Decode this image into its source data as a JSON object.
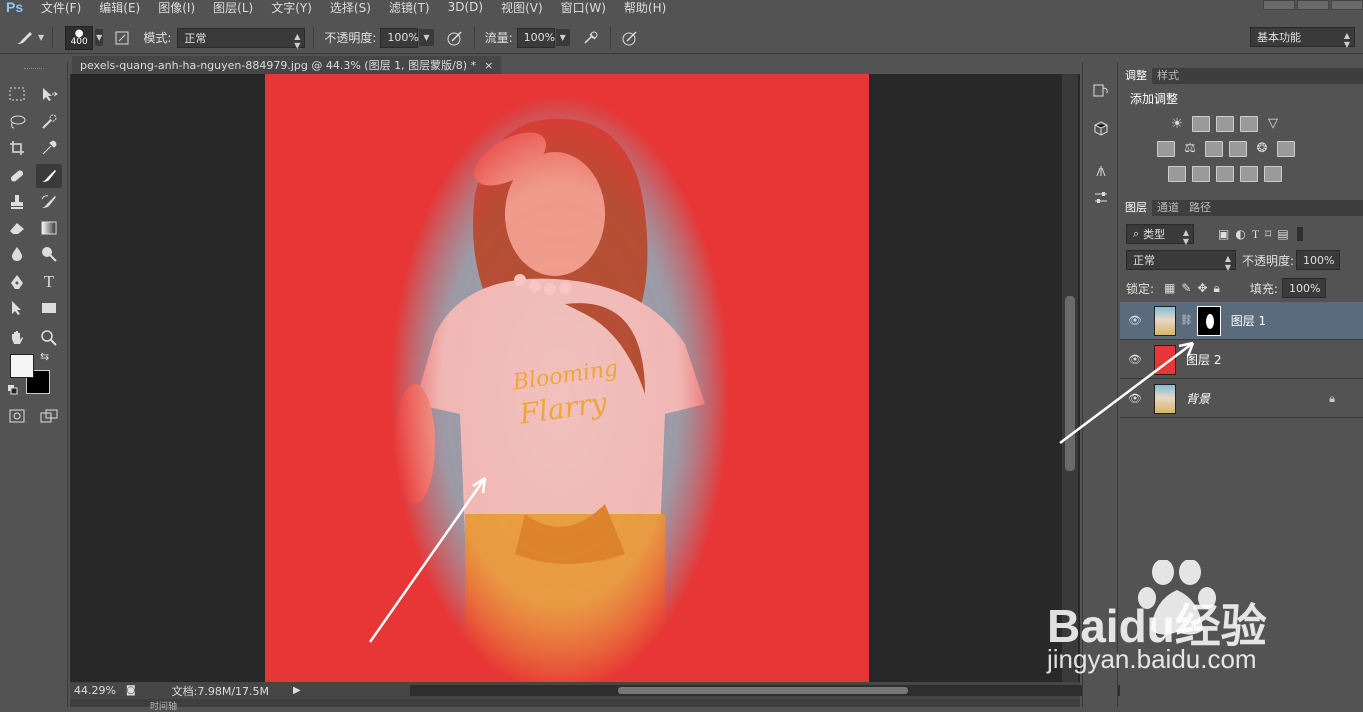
{
  "app": {
    "logo": "Ps"
  },
  "menu": [
    "文件(F)",
    "编辑(E)",
    "图像(I)",
    "图层(L)",
    "文字(Y)",
    "选择(S)",
    "滤镜(T)",
    "3D(D)",
    "视图(V)",
    "窗口(W)",
    "帮助(H)"
  ],
  "options": {
    "brush_size": "400",
    "mode_label": "模式:",
    "mode_value": "正常",
    "opacity_label": "不透明度:",
    "opacity_value": "100%",
    "flow_label": "流量:",
    "flow_value": "100%",
    "workspace": "基本功能"
  },
  "document": {
    "tab_title": "pexels-quang-anh-ha-nguyen-884979.jpg @ 44.3% (图层 1, 图层蒙版/8) *",
    "close_glyph": "×",
    "zoom": "44.29%",
    "doc_info": "文档:7.98M/17.5M",
    "timeline_label": "时间轴"
  },
  "adjustments_panel": {
    "tabs": [
      "调整",
      "样式"
    ],
    "title": "添加调整"
  },
  "layers_panel": {
    "tabs": [
      "图层",
      "通道",
      "路径"
    ],
    "filter_label": "类型",
    "blend_mode": "正常",
    "opacity_label": "不透明度:",
    "opacity_value": "100%",
    "lock_label": "锁定:",
    "fill_label": "填充:",
    "fill_value": "100%",
    "layers": [
      {
        "name": "图层 1",
        "selected": true,
        "has_mask": true
      },
      {
        "name": "图层 2",
        "selected": false,
        "color": "#e83535"
      },
      {
        "name": "背景",
        "selected": false,
        "locked": true
      }
    ]
  },
  "watermark": {
    "brand": "Baidu经验",
    "url": "jingyan.baidu.com"
  },
  "colors": {
    "accent_red": "#e83535",
    "selection_blue": "#5b6b7e"
  }
}
